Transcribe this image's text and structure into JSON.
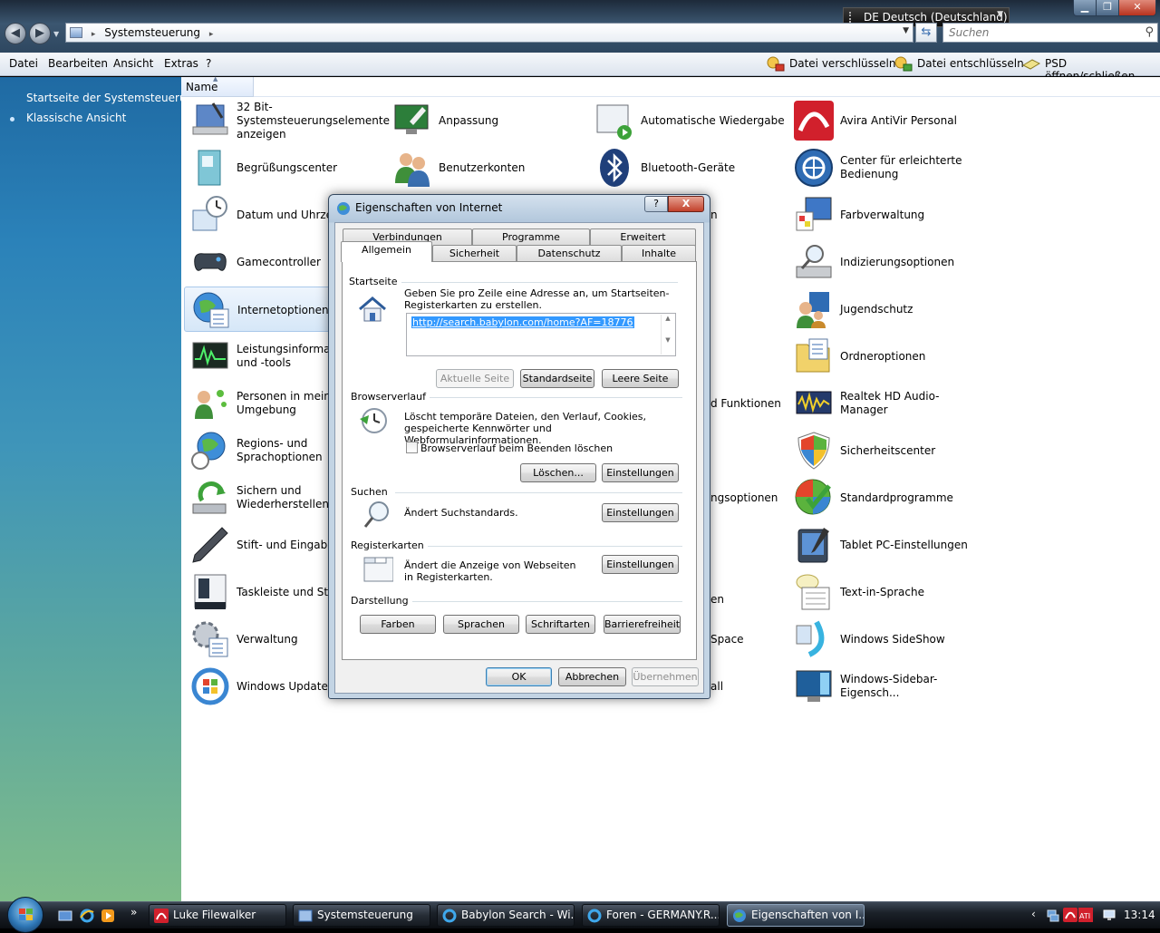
{
  "window": {
    "language_bar": "DE Deutsch (Deutschland)",
    "breadcrumb": "Systemsteuerung",
    "search_placeholder": "Suchen"
  },
  "menubar": {
    "menus": [
      "Datei",
      "Bearbeiten",
      "Ansicht",
      "Extras",
      "?"
    ],
    "tools": [
      "Datei verschlüsseln",
      "Datei entschlüsseln",
      "PSD öffnen/schließen"
    ]
  },
  "sidebar": {
    "home_link": "Startseite der Systemsteuerung",
    "classic_view": "Klassische Ansicht"
  },
  "content": {
    "column_header": "Name",
    "items_col1": [
      "32 Bit-Systemsteuerungselemente anzeigen",
      "Begrüßungscenter",
      "Datum und Uhrzeit",
      "Gamecontroller",
      "Internetoptionen",
      "Leistungsinformationen und -tools",
      "Personen in meiner Umgebung",
      "Regions- und Sprachoptionen",
      "Sichern und Wiederherstellen",
      "Stift- und Eingabegeräte",
      "Taskleiste und Startmenü",
      "Verwaltung",
      "Windows Update"
    ],
    "items_col2": [
      "Anpassung",
      "Benutzerkonten"
    ],
    "items_col3": [
      "Automatische Wiedergabe",
      "Bluetooth-Geräte"
    ],
    "col3_fragments": [
      "n",
      "d Funktionen",
      "ngsoptionen",
      "en",
      "Space",
      "all"
    ],
    "items_col4": [
      "Avira AntiVir Personal",
      "Center für erleichterte Bedienung",
      "Farbverwaltung",
      "Indizierungsoptionen",
      "Jugendschutz",
      "Ordneroptionen",
      "Realtek HD Audio-Manager",
      "Sicherheitscenter",
      "Standardprogramme",
      "Tablet PC-Einstellungen",
      "Text-in-Sprache",
      "Windows SideShow",
      "Windows-Sidebar-Eigensch..."
    ]
  },
  "dialog": {
    "title": "Eigenschaften von Internet",
    "help": "?",
    "close": "X",
    "tabs_row_back": [
      "Verbindungen",
      "Programme",
      "Erweitert"
    ],
    "tabs_row_front": [
      "Allgemein",
      "Sicherheit",
      "Datenschutz",
      "Inhalte"
    ],
    "startseite": {
      "title": "Startseite",
      "desc": "Geben Sie pro Zeile eine Adresse an, um Startseiten-Registerkarten zu erstellen.",
      "url": "http://search.babylon.com/home?AF=18776",
      "btn_current": "Aktuelle Seite",
      "btn_default": "Standardseite",
      "btn_blank": "Leere Seite"
    },
    "browserverlauf": {
      "title": "Browserverlauf",
      "desc": "Löscht temporäre Dateien, den Verlauf, Cookies, gespeicherte Kennwörter und Webformularinformationen.",
      "checkbox": "Browserverlauf beim Beenden löschen",
      "btn_delete": "Löschen...",
      "btn_settings": "Einstellungen"
    },
    "suchen": {
      "title": "Suchen",
      "desc": "Ändert Suchstandards.",
      "btn_settings": "Einstellungen"
    },
    "registerkarten": {
      "title": "Registerkarten",
      "desc": "Ändert die Anzeige von Webseiten in Registerkarten.",
      "btn_settings": "Einstellungen"
    },
    "darstellung": {
      "title": "Darstellung",
      "btn_colors": "Farben",
      "btn_languages": "Sprachen",
      "btn_fonts": "Schriftarten",
      "btn_accessibility": "Barrierefreiheit"
    },
    "btn_ok": "OK",
    "btn_cancel": "Abbrechen",
    "btn_apply": "Übernehmen"
  },
  "taskbar": {
    "tasks": [
      "Luke Filewalker",
      "Systemsteuerung",
      "Babylon Search - Wi...",
      "Foren - GERMANY.R...",
      "Eigenschaften von I..."
    ],
    "clock": "13:14",
    "quicklaunch_more": "»"
  }
}
